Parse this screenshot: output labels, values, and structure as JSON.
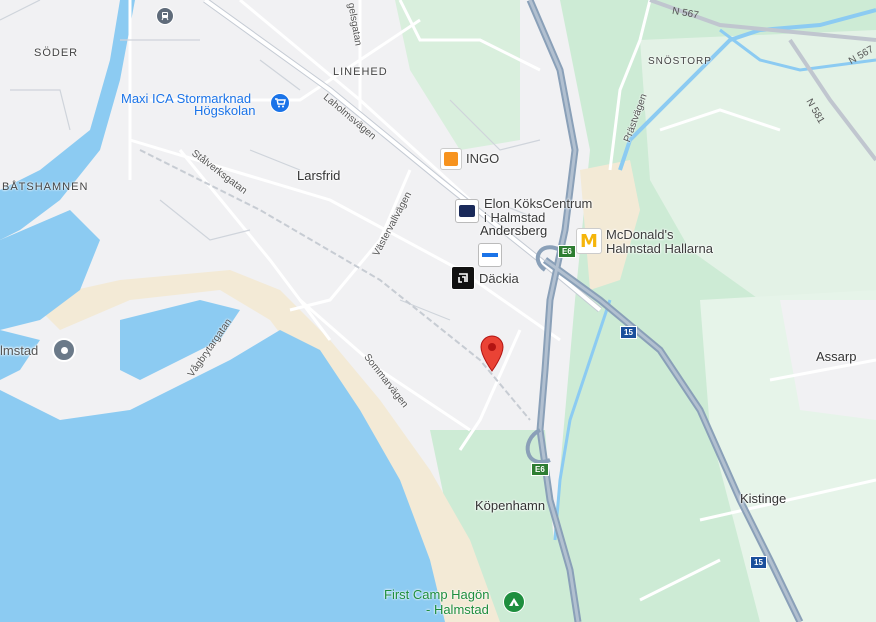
{
  "map": {
    "colors": {
      "land": "#f1f1f3",
      "water": "#8ccbf2",
      "green": "#cdebd5",
      "sand": "#f3ead6",
      "highway": "#8aa0b8",
      "road": "#ffffff",
      "pin": "#ea4335"
    },
    "areas": {
      "soder": "SÖDER",
      "linehed": "LINEHED",
      "snostorp": "SNÖSTORP",
      "batshamnen": "BÅTSHAMNEN",
      "larsfrid": "Larsfrid",
      "andersberg": "Andersberg",
      "assarp": "Assarp",
      "kistinge": "Kistinge",
      "kopenhamn": "Köpenhamn",
      "halmstad_partial": "lmstad"
    },
    "streets": {
      "gelsgatan": "gelsgatan",
      "lanolmsvagen": "Laholmsvägen",
      "stalverksgatan": "Stålverksgatan",
      "vastervallvagen": "Västervallvägen",
      "vagbrytargatan": "Vågbrytargatan",
      "sommarvagen": "Sommarvägen",
      "prastvagen": "Prästvägen"
    },
    "road_shields": {
      "n567_top": "N 567",
      "n567_right": "N 567",
      "n581": "N 581",
      "e6_top": "E6",
      "e6_bottom": "E6",
      "r15_top": "15",
      "r15_bottom": "15"
    },
    "pois": {
      "maxi_ica_line1": "Maxi ICA Stormarknad",
      "maxi_ica_line2": "Högskolan",
      "ingo": "INGO",
      "elon_line1": "Elon KöksCentrum",
      "elon_line2": "i Halmstad",
      "mcdonalds_line1": "McDonald's",
      "mcdonalds_line2": "Halmstad Hallarna",
      "dackia": "Däckia",
      "first_camp_line1": "First Camp Hagön",
      "first_camp_line2": "- Halmstad"
    },
    "icons": {
      "train": "train-station-icon",
      "cart": "shopping-cart-icon",
      "ingo": "fuel-station-icon",
      "elon": "elon-store-icon",
      "mcdonalds": "mcdonalds-icon",
      "dackia": "tire-shop-icon",
      "bestway": "bestway-icon",
      "camp": "campground-icon",
      "city": "city-marker-icon",
      "pin": "location-pin-icon"
    }
  }
}
